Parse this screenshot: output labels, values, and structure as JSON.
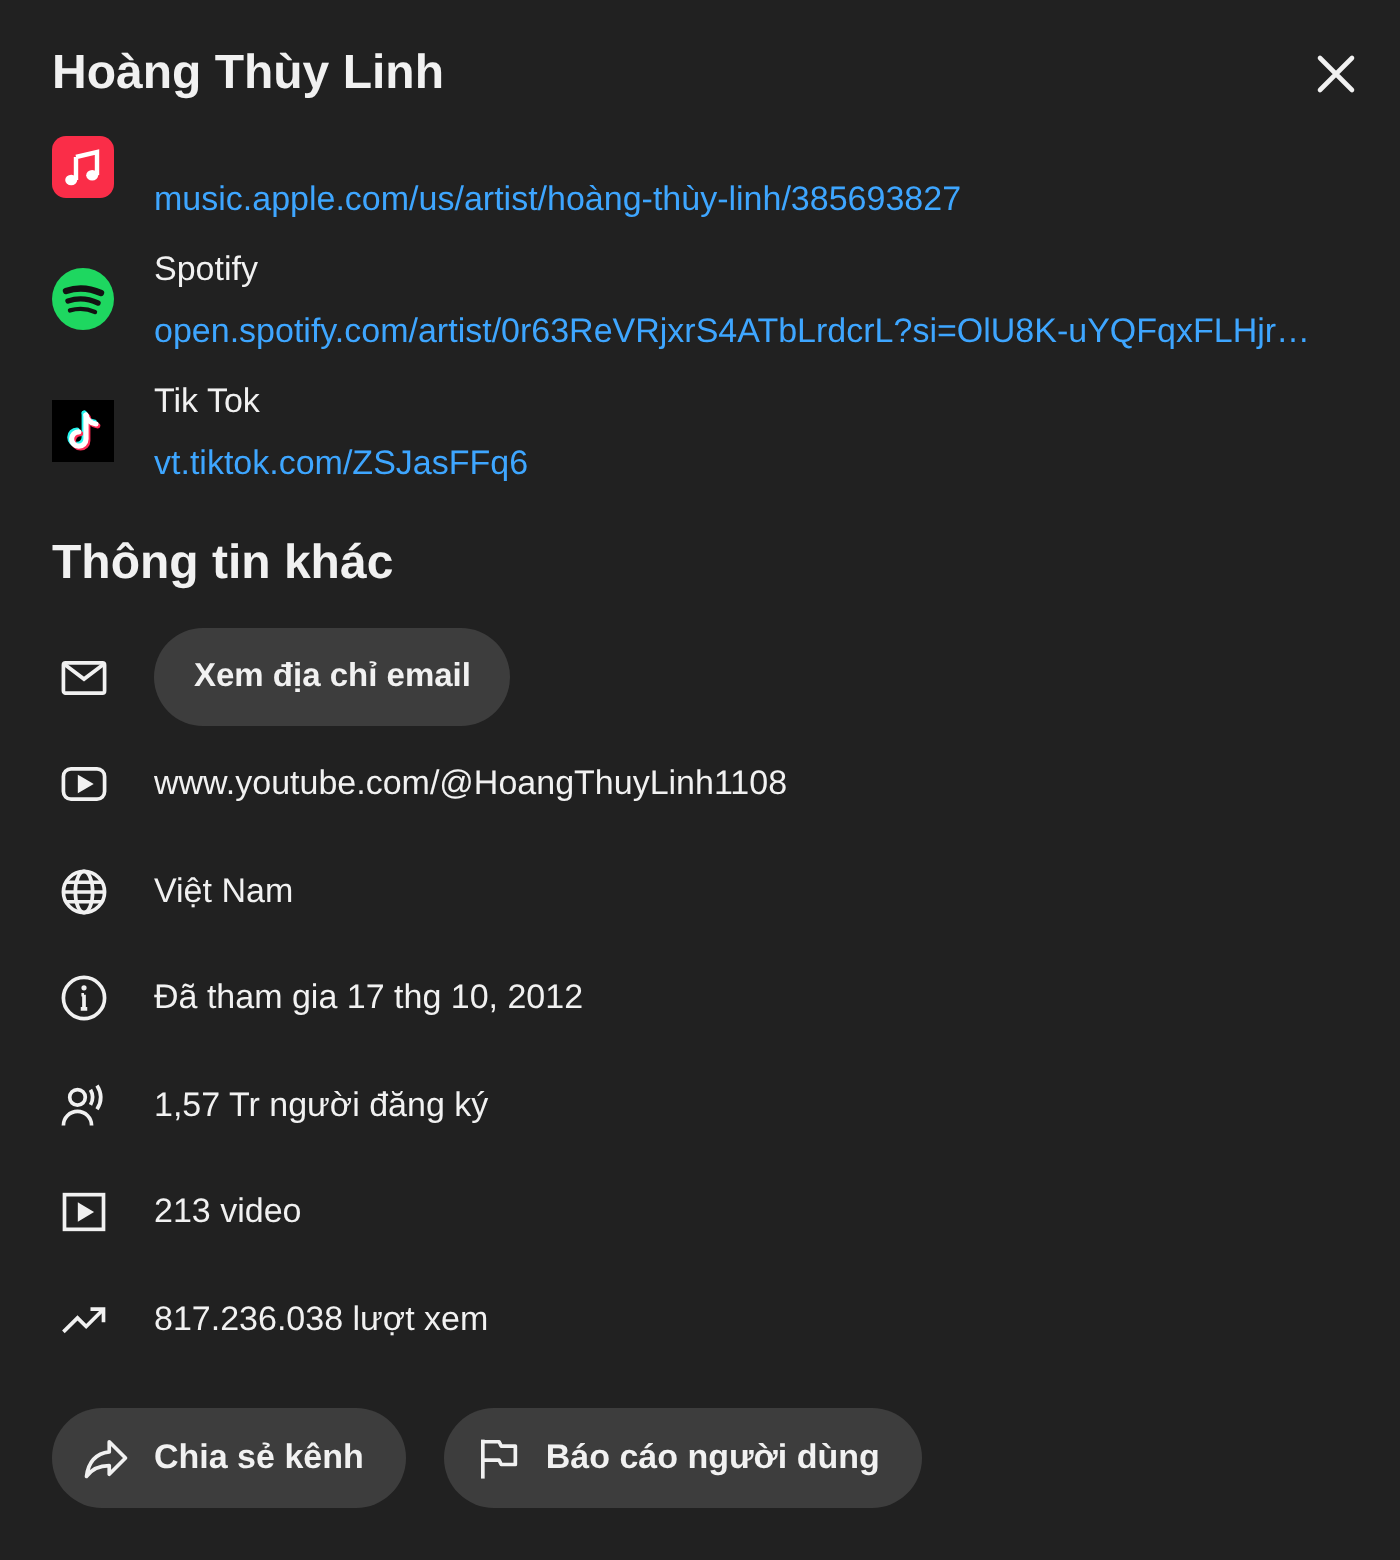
{
  "dialog": {
    "title": "Hoàng Thùy Linh"
  },
  "links": [
    {
      "kind": "apple_music",
      "url": "music.apple.com/us/artist/hoàng-thùy-linh/385693827"
    },
    {
      "kind": "spotify",
      "label": "Spotify",
      "url": "open.spotify.com/artist/0r63ReVRjxrS4ATbLrdcrL?si=OlU8K-uYQFqxFLHjr…"
    },
    {
      "kind": "tiktok",
      "label": "Tik Tok",
      "url": "vt.tiktok.com/ZSJasFFq6"
    }
  ],
  "more_info": {
    "heading": "Thông tin khác",
    "items": [
      {
        "kind": "email",
        "button": "Xem địa chỉ email"
      },
      {
        "kind": "link",
        "text": "www.youtube.com/@HoangThuyLinh1108"
      },
      {
        "kind": "location",
        "text": "Việt Nam"
      },
      {
        "kind": "joined",
        "text": "Đã tham gia 17 thg 10, 2012"
      },
      {
        "kind": "subscribers",
        "text": "1,57 Tr người đăng ký"
      },
      {
        "kind": "videos",
        "text": "213 video"
      },
      {
        "kind": "views",
        "text": "817.236.038 lượt xem"
      }
    ]
  },
  "actions": [
    {
      "kind": "share",
      "label": "Chia sẻ kênh"
    },
    {
      "kind": "report",
      "label": "Báo cáo người dùng"
    }
  ]
}
